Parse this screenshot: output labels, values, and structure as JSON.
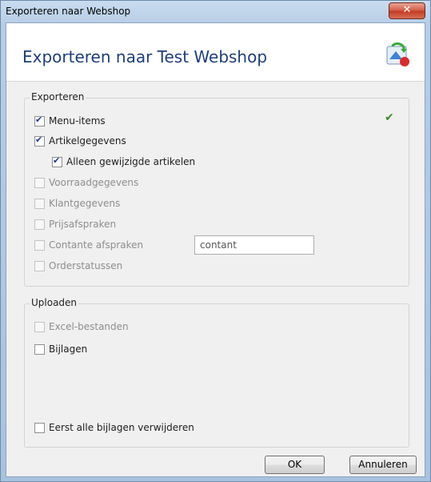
{
  "window": {
    "title": "Exporteren naar Webshop",
    "close_label": "✕"
  },
  "header": {
    "title": "Exporteren naar Test Webshop",
    "icon": "export-webshop-icon"
  },
  "export_group": {
    "label": "Exporteren",
    "options": [
      {
        "label": "Menu-items",
        "checked": true,
        "enabled": true
      },
      {
        "label": "Artikelgegevens",
        "checked": true,
        "enabled": true
      },
      {
        "label": "Alleen gewijzigde artikelen",
        "checked": true,
        "enabled": true
      },
      {
        "label": "Voorraadgegevens",
        "checked": false,
        "enabled": false
      },
      {
        "label": "Klantgegevens",
        "checked": false,
        "enabled": false
      },
      {
        "label": "Prijsafspraken",
        "checked": false,
        "enabled": false
      },
      {
        "label": "Contante afspraken",
        "checked": false,
        "enabled": false
      },
      {
        "label": "Orderstatussen",
        "checked": false,
        "enabled": false
      }
    ],
    "contant_field_value": "contant",
    "status_icon": "double-check-icon"
  },
  "upload_group": {
    "label": "Uploaden",
    "options": [
      {
        "label": "Excel-bestanden",
        "checked": false,
        "enabled": false
      },
      {
        "label": "Bijlagen",
        "checked": false,
        "enabled": true
      },
      {
        "label": "Eerst alle bijlagen verwijderen",
        "checked": false,
        "enabled": true
      }
    ]
  },
  "buttons": {
    "ok": "OK",
    "cancel": "Annuleren"
  }
}
